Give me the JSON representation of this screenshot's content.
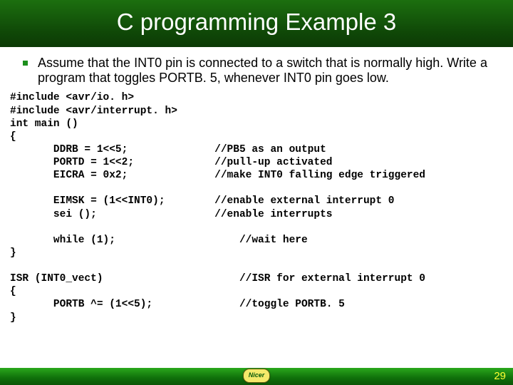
{
  "slide": {
    "title": "C programming Example 3",
    "bullet": "Assume that the INT0 pin is connected to a switch that is normally high. Write a program that toggles PORTB. 5, whenever INT0 pin goes low.",
    "code": "#include <avr/io. h>\n#include <avr/interrupt. h>\nint main ()\n{\n       DDRB = 1<<5;              //PB5 as an output\n       PORTD = 1<<2;             //pull-up activated\n       EICRA = 0x2;              //make INT0 falling edge triggered\n\n       EIMSK = (1<<INT0);        //enable external interrupt 0\n       sei ();                   //enable interrupts\n\n       while (1);                    //wait here\n}\n\nISR (INT0_vect)                      //ISR for external interrupt 0\n{\n       PORTB ^= (1<<5);              //toggle PORTB. 5\n}",
    "logo_text": "Nicer",
    "page_number": "29"
  }
}
